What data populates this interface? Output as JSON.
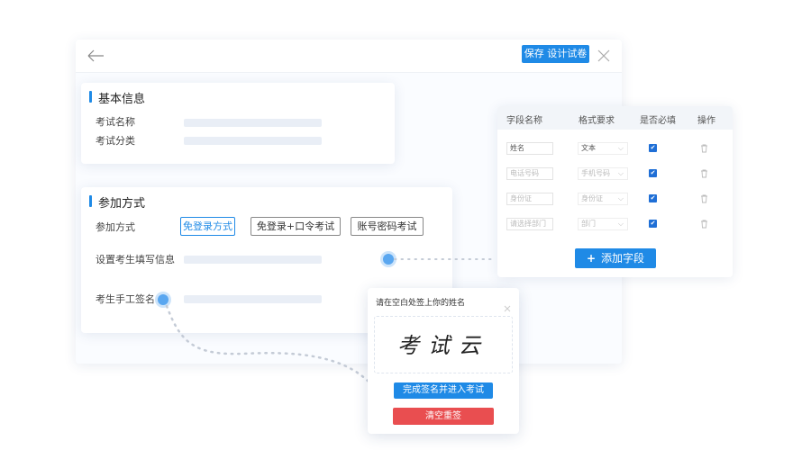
{
  "toolbar": {
    "save_label": "保存 设计试卷",
    "back_icon": "arrow-left-icon",
    "close_icon": "close-icon"
  },
  "basic_info": {
    "title": "基本信息",
    "rows": [
      {
        "label": "考试名称"
      },
      {
        "label": "考试分类"
      }
    ]
  },
  "join": {
    "title": "参加方式",
    "method_label": "参加方式",
    "options": [
      "免登录方式",
      "免登录+口令考试",
      "账号密码考试"
    ],
    "selected_option": "免登录方式",
    "fill_info_label": "设置考生填写信息",
    "signature_label": "考生手工签名"
  },
  "fields_table": {
    "headers": [
      "字段名称",
      "格式要求",
      "是否必填",
      "操作"
    ],
    "rows": [
      {
        "name": "姓名",
        "format": "文本",
        "required": true
      },
      {
        "name": "电话号码",
        "format": "手机号码",
        "required": true
      },
      {
        "name": "身份证",
        "format": "身份证",
        "required": true
      },
      {
        "name": "请选择部门",
        "format": "部门",
        "required": true
      }
    ],
    "add_label": "添加字段"
  },
  "signature_dialog": {
    "prompt": "请在空白处签上你的姓名",
    "signature_text": "考试云",
    "confirm_label": "完成签名并进入考试",
    "clear_label": "清空重签"
  },
  "colors": {
    "accent": "#1f8ae6",
    "danger": "#e94e50",
    "checkbox": "#1f6fd6"
  }
}
